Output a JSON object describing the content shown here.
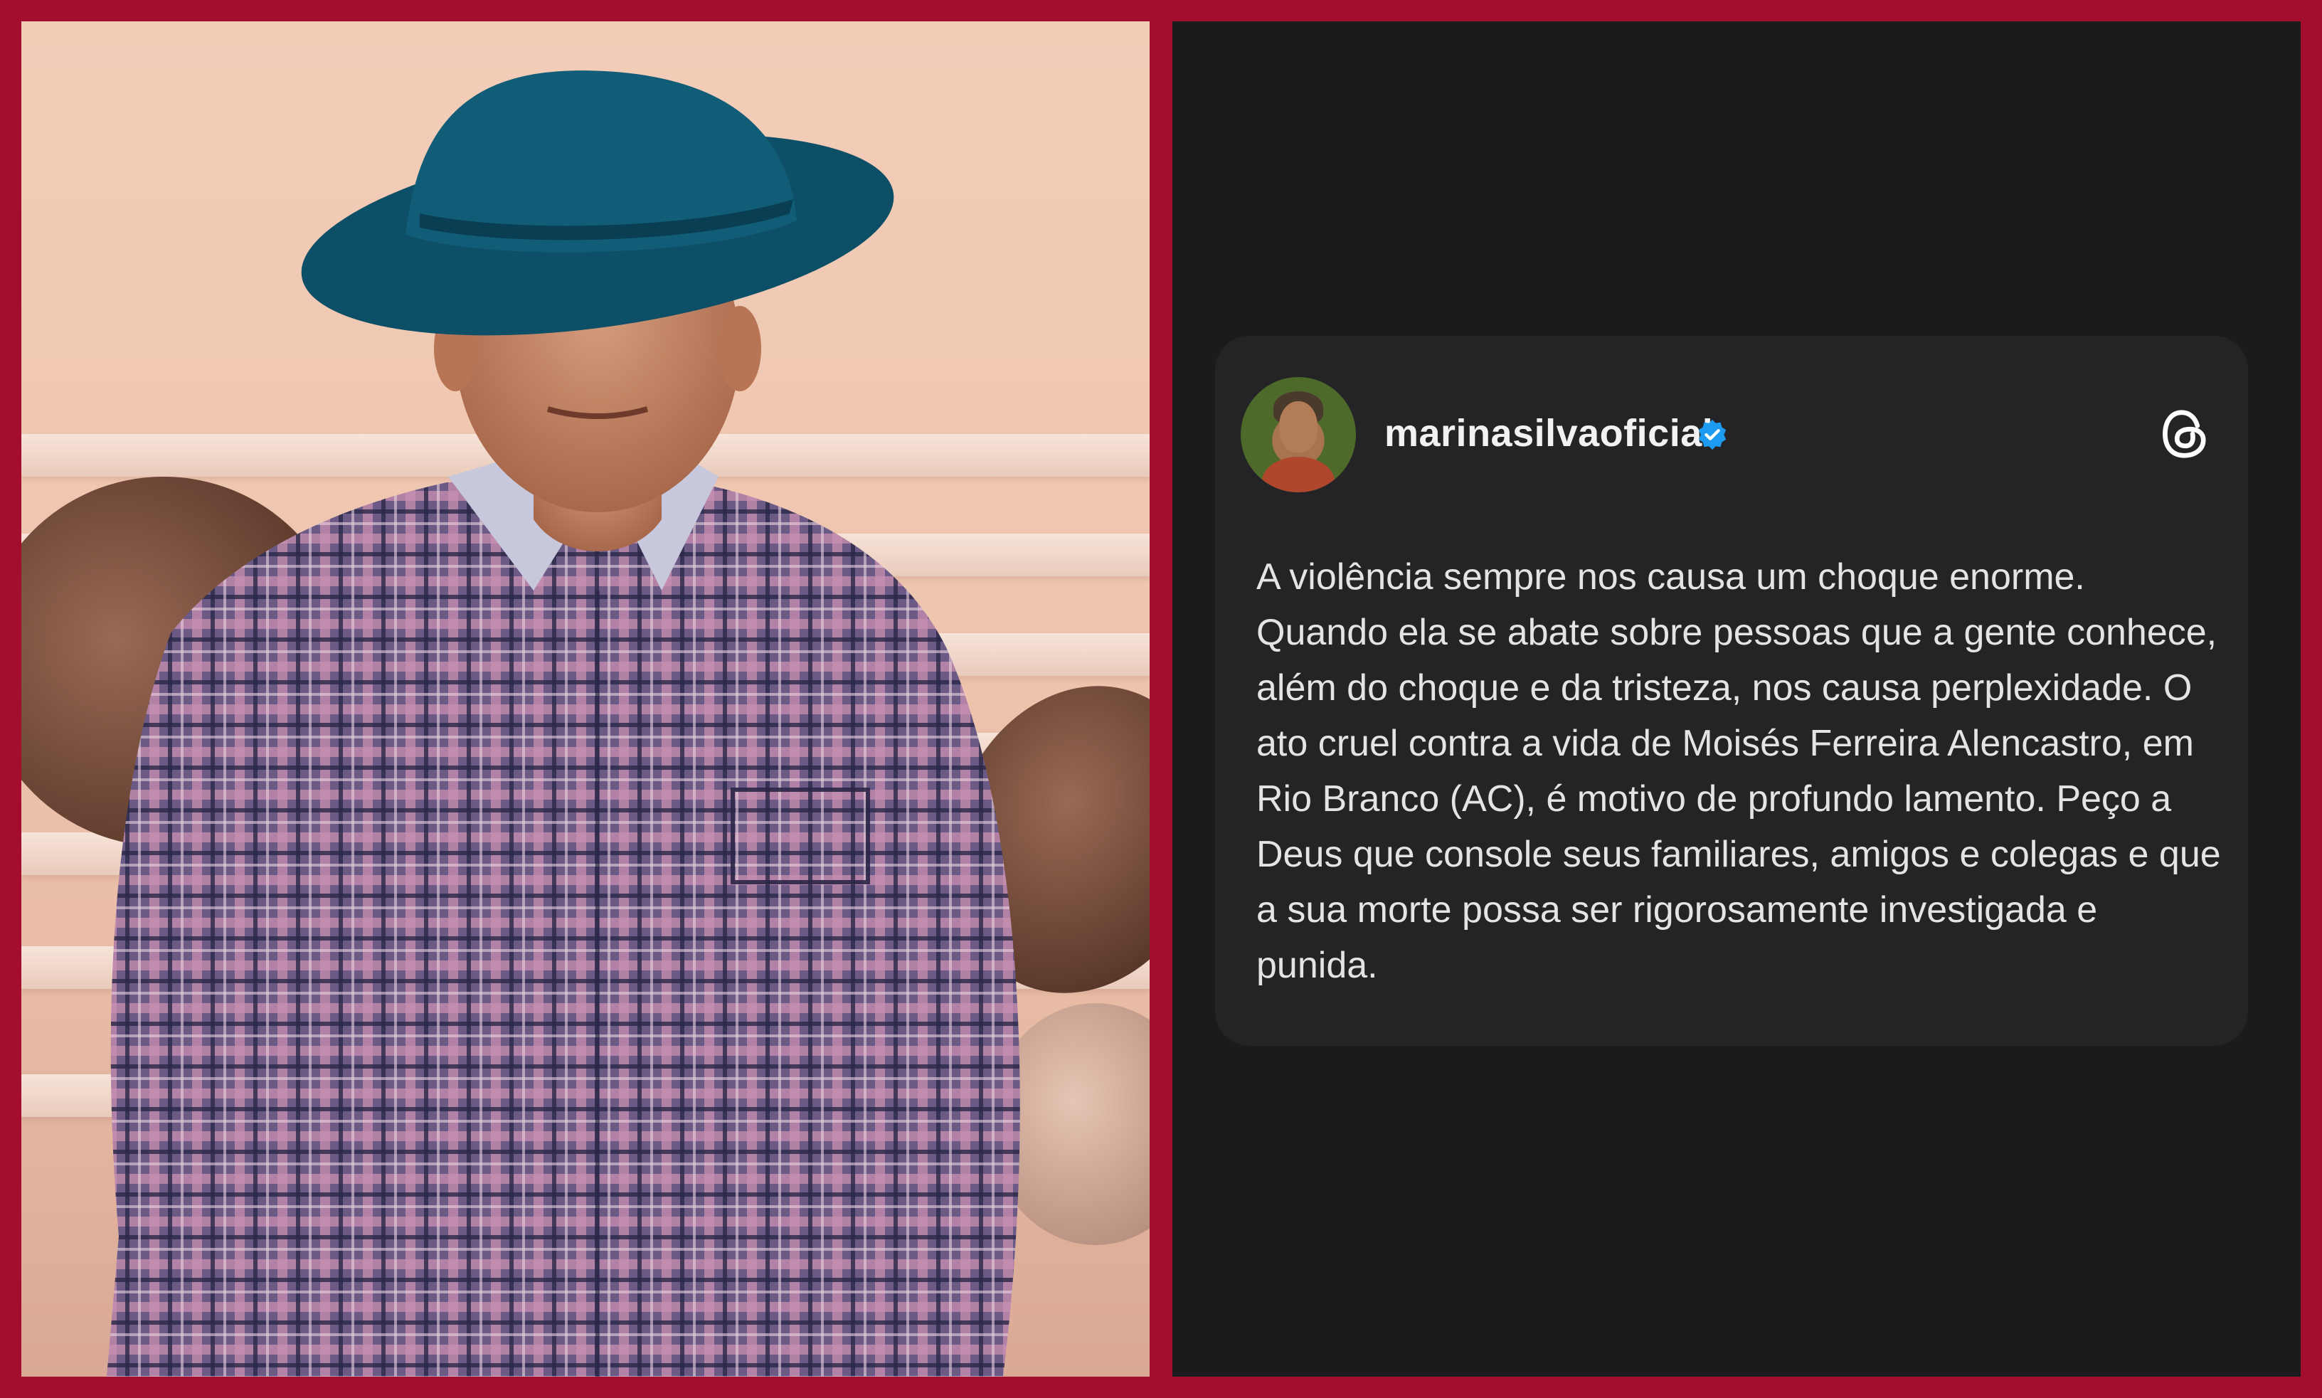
{
  "post": {
    "username": "marinasilvaoficial",
    "verified_icon": "verified-badge-icon",
    "app_icon": "threads-icon",
    "text": "A violência sempre nos causa um choque enorme. Quando ela se abate sobre pessoas que a gente conhece, além do choque e da tristeza, nos causa perplexidade. O ato cruel contra a vida de Moisés Ferreira Alencastro, em Rio Branco (AC), é motivo de profundo lamento. Peço a Deus que console seus familiares, amigos e colegas e que a sua morte possa ser rigorosamente investigada e punida."
  },
  "colors": {
    "frame": "#a30d2e",
    "dark_panel": "#1b1b1d",
    "card": "#242426",
    "verified": "#1d9bf0"
  }
}
